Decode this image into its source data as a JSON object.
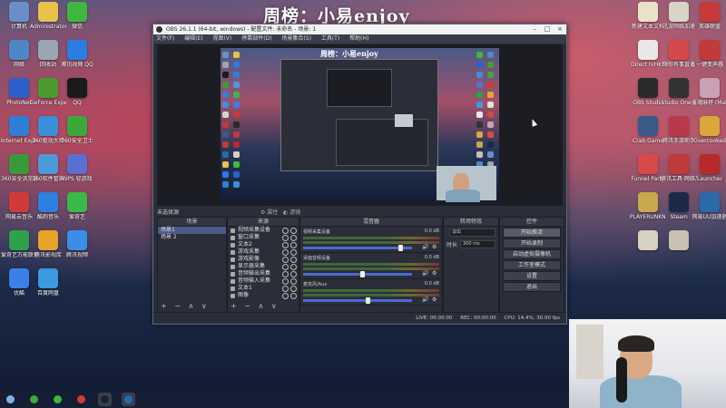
{
  "watermark": {
    "text": "周榜：小易enjoy"
  },
  "desktop_left": [
    {
      "label": "计算机",
      "color": "#6a8fc8"
    },
    {
      "label": "Administrator",
      "color": "#e8c24a"
    },
    {
      "label": "微信",
      "color": "#3db83d"
    },
    {
      "label": "网络",
      "color": "#4f86c6"
    },
    {
      "label": "回收站",
      "color": "#9aa6b2"
    },
    {
      "label": "腾讯视频 QQ",
      "color": "#2a7de1"
    },
    {
      "label": "PhotoNet",
      "color": "#2d5fcf"
    },
    {
      "label": "GeForce Experience",
      "color": "#4b9a30"
    },
    {
      "label": "QQ",
      "color": "#1a1a1a"
    },
    {
      "label": "Internet Explorer",
      "color": "#2f7fd4"
    },
    {
      "label": "360驱动大师",
      "color": "#3b8fd8"
    },
    {
      "label": "360安全卫士",
      "color": "#3ba83b"
    },
    {
      "label": "360安全浏览器",
      "color": "#3a9a3a"
    },
    {
      "label": "360软件管家",
      "color": "#4e9ad8"
    },
    {
      "label": "WPS 轻游戏",
      "color": "#5b6fd1"
    },
    {
      "label": "网易云音乐",
      "color": "#d23a3a"
    },
    {
      "label": "酷狗音乐",
      "color": "#2f7fe0"
    },
    {
      "label": "爱奇艺",
      "color": "#3bb84a"
    },
    {
      "label": "爱奇艺万能联播",
      "color": "#2da14b"
    },
    {
      "label": "腾讯影视库",
      "color": "#e8a42a"
    },
    {
      "label": "腾讯视频",
      "color": "#3b8ee8"
    },
    {
      "label": "优酷",
      "color": "#3b7fe8"
    },
    {
      "label": "百度网盘",
      "color": "#3a9ae0"
    }
  ],
  "desktop_right": [
    {
      "label": "新建文本文档",
      "color": "#e8e2c8"
    },
    {
      "label": "迅游网络加速",
      "color": "#d8d4c8"
    },
    {
      "label": "英雄联盟",
      "color": "#c83a3a"
    },
    {
      "label": "Direct IVHKS",
      "color": "#e8e8e8"
    },
    {
      "label": "嗨你有事直播",
      "color": "#d34a4a"
    },
    {
      "label": "一键变声器",
      "color": "#c23a3a"
    },
    {
      "label": "OBS Studio",
      "color": "#2a2a2a"
    },
    {
      "label": "Studio One 4",
      "color": "#333333"
    },
    {
      "label": "雀魂麻将 (Mahjong...)",
      "color": "#c8a0b8"
    },
    {
      "label": "Crab Game",
      "color": "#3a5a8a"
    },
    {
      "label": "腾讯手游助手",
      "color": "#b83a4a"
    },
    {
      "label": "Overcooked",
      "color": "#d8a83a"
    },
    {
      "label": "Funnel Party",
      "color": "#d84a4a"
    },
    {
      "label": "腾讯工具·网络加速器",
      "color": "#c03a3a"
    },
    {
      "label": "Launcher",
      "color": "#b82a2a"
    },
    {
      "label": "PLAYERUNKNOWN'S BATTLEGR...",
      "color": "#c8a84a"
    },
    {
      "label": "Steam",
      "color": "#1b2a48"
    },
    {
      "label": "网易UU加速器",
      "color": "#2a6aa8"
    },
    {
      "label": "",
      "color": "#d8d0c0"
    },
    {
      "label": "",
      "color": "#c8c0b0"
    }
  ],
  "obs": {
    "title": "OBS 26.1.1 (64-bit, windows) - 配置文件: 未命名 - 场景: 1",
    "menu": [
      "文件(F)",
      "编辑(E)",
      "视图(V)",
      "停靠部件(D)",
      "场景集合(S)",
      "工具(T)",
      "帮助(H)"
    ],
    "inner_title": "周榜：小易enjoy",
    "scene_label": "未选择源",
    "scene_tools": [
      "⚙ 属性",
      "◐ 滤镜"
    ],
    "docks": {
      "scenes": {
        "header": "场景",
        "items": [
          "场景1",
          "场景 2"
        ]
      },
      "sources": {
        "header": "来源",
        "items": [
          "视频采集设备",
          "窗口采集",
          "文本2",
          "游戏采集",
          "游戏影像",
          "显示器采集",
          "音频输出采集",
          "音频输入采集",
          "文本1",
          "图像"
        ]
      },
      "mixer": {
        "header": "混音器",
        "channels": [
          {
            "name": "视频采集设备",
            "db": "0.0 dB",
            "level": 0.9
          },
          {
            "name": "桌面音频设备",
            "db": "0.0 dB",
            "level": 0.55
          },
          {
            "name": "麦克风/Aux",
            "db": "0.0 dB",
            "level": 0.6
          }
        ]
      },
      "transitions": {
        "header": "转场特效",
        "type": "淡出",
        "duration_label": "时长",
        "duration": "300 ms"
      },
      "controls": {
        "header": "控件",
        "buttons": [
          "开始推流",
          "开始录制",
          "启动虚拟摄像机",
          "工作室模式",
          "设置",
          "退出"
        ]
      }
    },
    "dock_footer": "+ − ∧ ∨",
    "status": [
      "LIVE: 00:00:00",
      "REC: 00:00:00",
      "CPU: 14.4%, 30.00 fps"
    ]
  }
}
